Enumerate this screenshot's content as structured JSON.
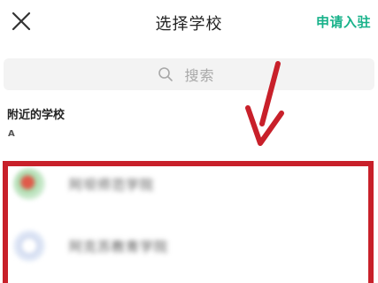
{
  "header": {
    "close_icon": "close-icon",
    "title": "选择学校",
    "apply_label": "申请入驻"
  },
  "search": {
    "icon": "search-icon",
    "placeholder": "搜索"
  },
  "nearby": {
    "section_title": "附近的学校",
    "index_letter": "A",
    "schools": [
      {
        "name": "阿坝师范学院",
        "avatar": "school-logo-green"
      },
      {
        "name": "阿克苏教育学院",
        "avatar": "school-logo-blue"
      }
    ]
  },
  "colors": {
    "accent": "#18b28a",
    "annotation": "#c8202a",
    "search_bg": "#f3f3f3"
  }
}
